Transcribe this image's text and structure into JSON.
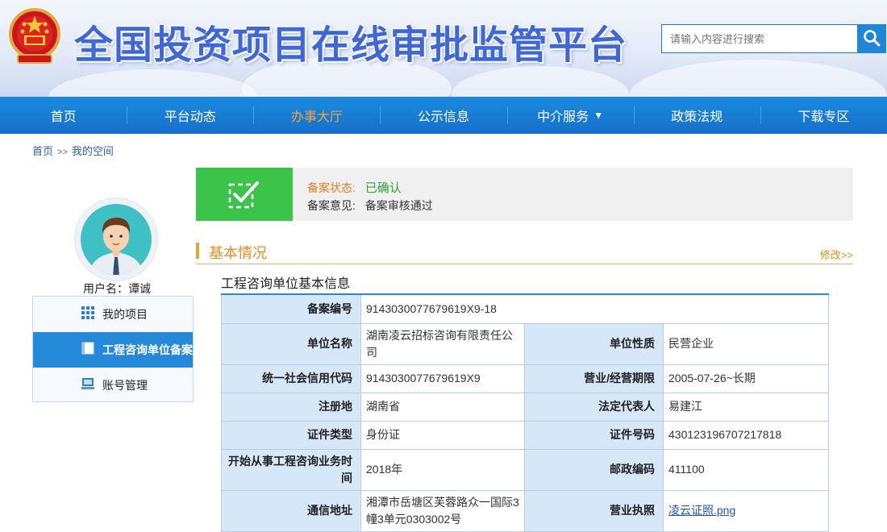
{
  "header": {
    "site_title": "全国投资项目在线审批监管平台",
    "search_placeholder": "请输入内容进行搜索"
  },
  "nav": {
    "items": [
      {
        "label": "首页",
        "active": false
      },
      {
        "label": "平台动态",
        "active": false
      },
      {
        "label": "办事大厅",
        "active": true
      },
      {
        "label": "公示信息",
        "active": false
      },
      {
        "label": "中介服务",
        "active": false,
        "caret": "▼"
      },
      {
        "label": "政策法规",
        "active": false
      },
      {
        "label": "下载专区",
        "active": false
      }
    ]
  },
  "breadcrumb": {
    "home": "首页",
    "separator": ">>",
    "current": "我的空间"
  },
  "user": {
    "username_label": "用户名：谭诚"
  },
  "sidebar": {
    "items": [
      {
        "label": "我的项目",
        "icon": "grid-icon",
        "active": false
      },
      {
        "label": "工程咨询单位备案",
        "icon": "document-icon",
        "active": true
      },
      {
        "label": "账号管理",
        "icon": "computer-icon",
        "active": false
      }
    ]
  },
  "status": {
    "state_label": "备案状态:",
    "state_value": "已确认",
    "opinion_label": "备案意见:",
    "opinion_value": "备案审核通过"
  },
  "section": {
    "title": "基本情况",
    "edit_link": "修改>>",
    "subtitle": "工程咨询单位基本信息"
  },
  "table": {
    "record_no_label": "备案编号",
    "record_no": "9143030077679619X9-18",
    "rows": [
      {
        "k1": "单位名称",
        "v1": "湖南凌云招标咨询有限责任公司",
        "k2": "单位性质",
        "v2": "民营企业"
      },
      {
        "k1": "统一社会信用代码",
        "v1": "9143030077679619X9",
        "k2": "营业/经营期限",
        "v2": "2005-07-26~长期"
      },
      {
        "k1": "注册地",
        "v1": "湖南省",
        "k2": "法定代表人",
        "v2": "易建江"
      },
      {
        "k1": "证件类型",
        "v1": "身份证",
        "k2": "证件号码",
        "v2": "430123196707217818"
      },
      {
        "k1": "开始从事工程咨询业务时间",
        "v1": "2018年",
        "k2": "邮政编码",
        "v2": "411100"
      },
      {
        "k1": "通信地址",
        "v1": "湘潭市岳塘区芙蓉路众一国际3幢3单元0303002号",
        "k2": "营业执照",
        "v2": "凌云证照.png"
      }
    ]
  },
  "colors": {
    "primary_blue": "#1a8ae0",
    "active_orange": "#f3a33c",
    "status_green": "#3bc34a",
    "table_key_bg": "#d6e7f7"
  }
}
